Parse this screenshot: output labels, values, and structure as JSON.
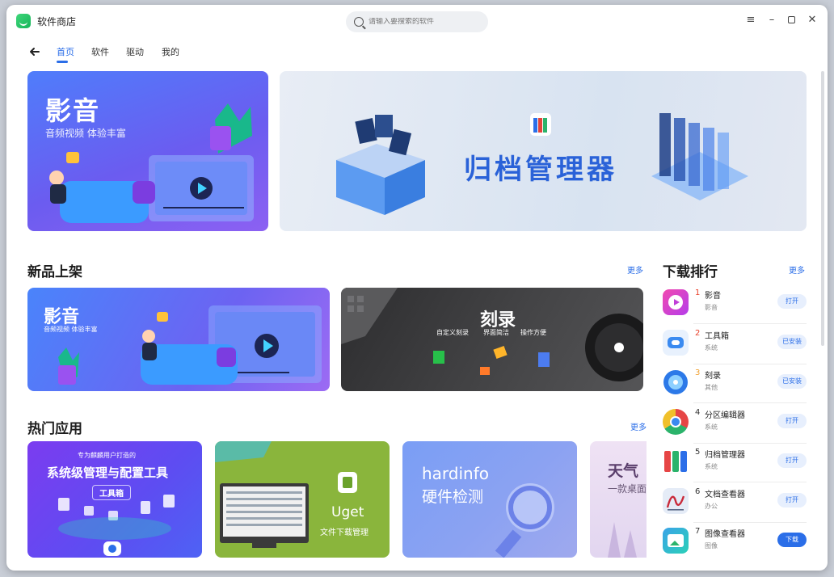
{
  "app": {
    "title": "软件商店"
  },
  "search": {
    "placeholder": "请输入要搜索的软件"
  },
  "nav": {
    "tabs": [
      "首页",
      "软件",
      "驱动",
      "我的"
    ]
  },
  "banners": {
    "b1": {
      "title": "影音",
      "subtitle": "音频视频 体验丰富"
    },
    "b2": {
      "title": "归档管理器"
    }
  },
  "new_section": {
    "title": "新品上架",
    "more": "更多",
    "card1": {
      "title": "影音",
      "subtitle": "音频视频 体验丰富"
    },
    "card2": {
      "title": "刻录",
      "features": [
        "自定义刻录",
        "界面简洁",
        "操作方便"
      ]
    }
  },
  "hot_section": {
    "title": "热门应用",
    "more": "更多",
    "card1": {
      "top": "专为麒麟用户打造的",
      "title": "系统级管理与配置工具",
      "badge": "工具箱"
    },
    "card2": {
      "title": "Uget",
      "subtitle": "文件下载管理"
    },
    "card3": {
      "title": "hardinfo",
      "subtitle": "硬件检测"
    },
    "card4": {
      "title": "天气",
      "subtitle": "一款桌面"
    }
  },
  "ranking": {
    "title": "下载排行",
    "more": "更多",
    "items": [
      {
        "rank": "1",
        "name": "影音",
        "category": "影音",
        "button": "打开",
        "color": "#e73fa8"
      },
      {
        "rank": "2",
        "name": "工具箱",
        "category": "系统",
        "button": "已安装",
        "color": "#3a8af0"
      },
      {
        "rank": "3",
        "name": "刻录",
        "category": "其他",
        "button": "已安装",
        "color": "#2c79e8"
      },
      {
        "rank": "4",
        "name": "分区编辑器",
        "category": "系统",
        "button": "打开",
        "color": "#f0a82a"
      },
      {
        "rank": "5",
        "name": "归档管理器",
        "category": "系统",
        "button": "打开",
        "color": "#e64545"
      },
      {
        "rank": "6",
        "name": "文档查看器",
        "category": "办公",
        "button": "打开",
        "color": "#c92a3a"
      },
      {
        "rank": "7",
        "name": "图像查看器",
        "category": "图像",
        "button": "下载",
        "color": "#3ba3e8"
      }
    ]
  }
}
